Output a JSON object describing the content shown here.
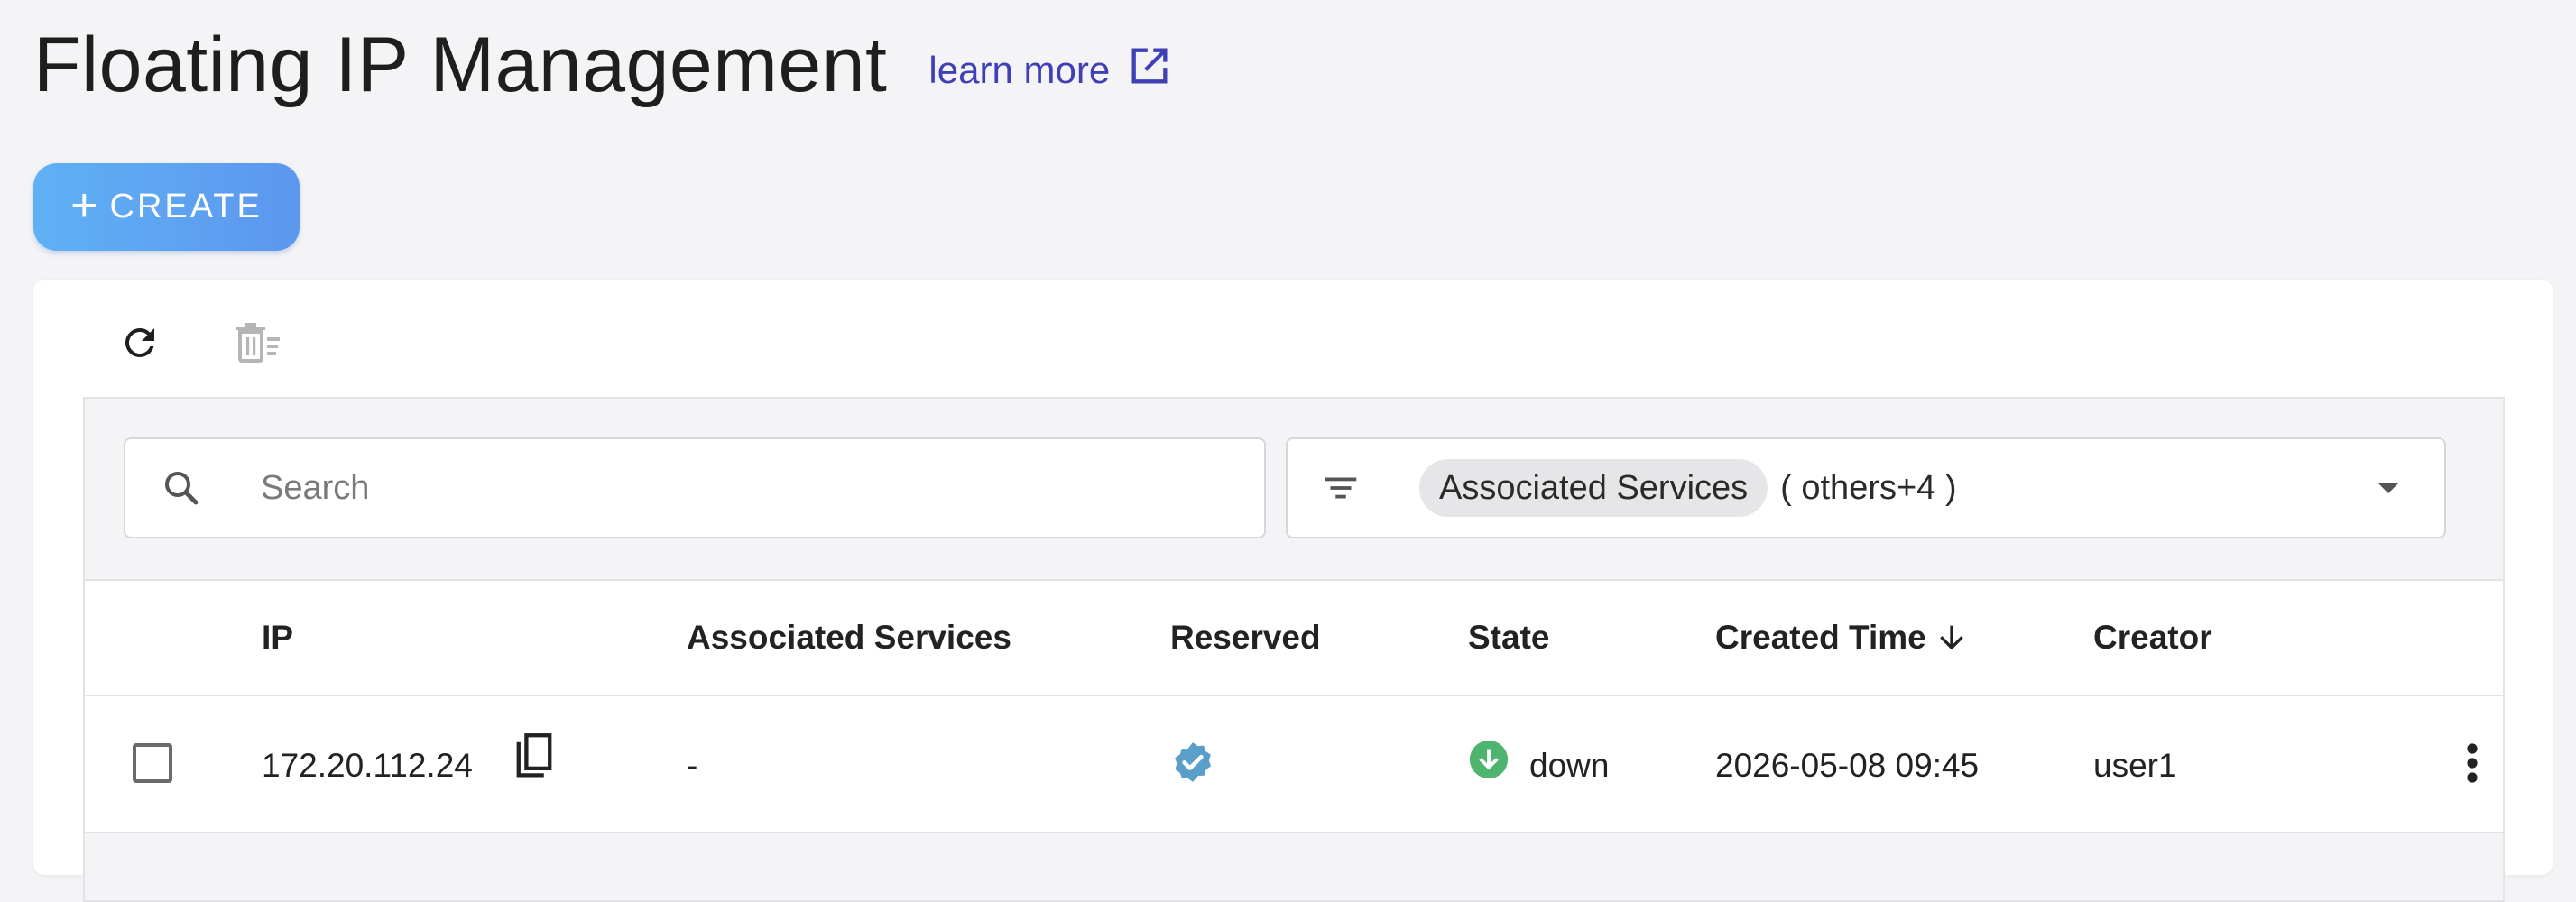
{
  "header": {
    "title": "Floating IP Management",
    "learn_more": "learn more"
  },
  "toolbar": {
    "create_label": "CREATE",
    "refresh_icon": "refresh-icon",
    "batch_delete_icon": "batch-delete-icon"
  },
  "search": {
    "placeholder": "Search",
    "value": ""
  },
  "filter": {
    "chip_label": "Associated Services",
    "extra_label": "( others+4 )"
  },
  "table": {
    "columns": [
      "IP",
      "Associated Services",
      "Reserved",
      "State",
      "Created Time",
      "Creator"
    ],
    "sort_column": "Created Time",
    "sort_direction": "desc",
    "rows": [
      {
        "ip": "172.20.112.24",
        "associated_services": "-",
        "reserved": true,
        "state": "down",
        "created_time": "2026-05-08 09:45",
        "creator": "user1"
      }
    ]
  },
  "colors": {
    "accent": "#3f3fb8",
    "create_gradient_start": "#5fb1f4",
    "create_gradient_end": "#5c97ee",
    "reserved_badge": "#5a9fc9",
    "state_down": "#4fb46e"
  }
}
